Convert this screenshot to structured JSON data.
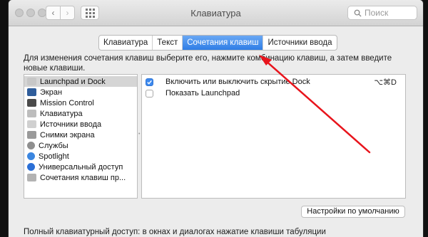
{
  "window": {
    "title": "Клавиатура"
  },
  "search": {
    "placeholder": "Поиск"
  },
  "tabs": [
    {
      "label": "Клавиатура",
      "active": false
    },
    {
      "label": "Текст",
      "active": false
    },
    {
      "label": "Сочетания клавиш",
      "active": true
    },
    {
      "label": "Источники ввода",
      "active": false
    }
  ],
  "description": "Для изменения сочетания клавиш выберите его, нажмите комбинацию клавиш, а затем введите новые клавиши.",
  "categories": [
    {
      "label": "Launchpad и Dock",
      "selected": true,
      "icon": "launchpad-icon"
    },
    {
      "label": "Экран",
      "icon": "display-icon"
    },
    {
      "label": "Mission Control",
      "icon": "mission-control-icon"
    },
    {
      "label": "Клавиатура",
      "icon": "keyboard-icon"
    },
    {
      "label": "Источники ввода",
      "icon": "input-sources-icon"
    },
    {
      "label": "Снимки экрана",
      "icon": "screenshot-icon"
    },
    {
      "label": "Службы",
      "icon": "services-gear-icon"
    },
    {
      "label": "Spotlight",
      "icon": "spotlight-icon"
    },
    {
      "label": "Универсальный доступ",
      "icon": "accessibility-icon"
    },
    {
      "label": "Сочетания клавиш пр...",
      "icon": "app-shortcuts-icon"
    }
  ],
  "shortcuts": [
    {
      "label": "Включить или выключить скрытие Dock",
      "checked": true,
      "key": "⌥⌘D"
    },
    {
      "label": "Показать Launchpad",
      "checked": false,
      "key": ""
    }
  ],
  "defaults_button": "Настройки по умолчанию",
  "footer": "Полный клавиатурный доступ: в окнах и диалогах нажатие клавиши табуляции",
  "colors": {
    "accent": "#3d89ee",
    "annotation_arrow": "#e8141c"
  }
}
